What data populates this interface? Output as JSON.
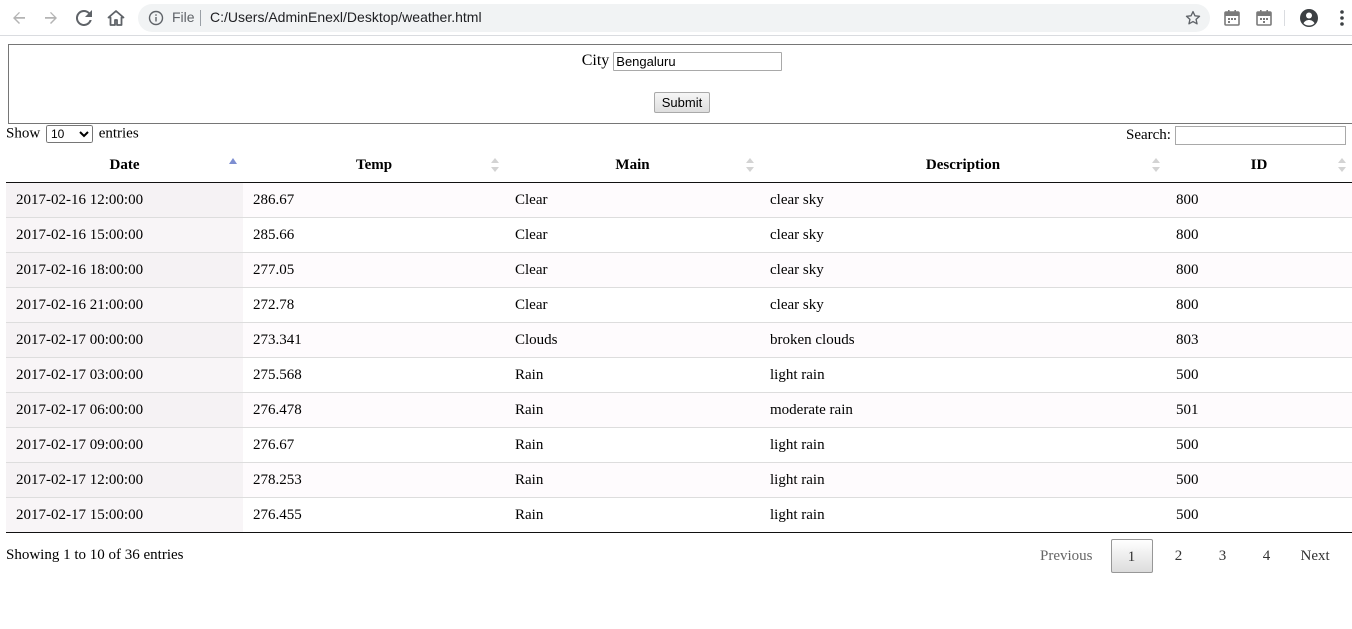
{
  "browser": {
    "file_label": "File",
    "url": "C:/Users/AdminEnexl/Desktop/weather.html",
    "icons": [
      "back-icon",
      "forward-icon",
      "reload-icon",
      "home-icon",
      "info-icon",
      "star-icon",
      "calendar-icon",
      "calendar-icon",
      "account-icon",
      "more-icon"
    ]
  },
  "form": {
    "city_label": "City",
    "city_value": "Bengaluru",
    "submit_label": "Submit"
  },
  "table_controls": {
    "show_label": "Show",
    "entries_label": "entries",
    "page_length": "10",
    "search_label": "Search:"
  },
  "table": {
    "columns": [
      "Date",
      "Temp",
      "Main",
      "Description",
      "ID"
    ],
    "sorted_column": "Date",
    "rows": [
      [
        "2017-02-16 12:00:00",
        "286.67",
        "Clear",
        "clear sky",
        "800"
      ],
      [
        "2017-02-16 15:00:00",
        "285.66",
        "Clear",
        "clear sky",
        "800"
      ],
      [
        "2017-02-16 18:00:00",
        "277.05",
        "Clear",
        "clear sky",
        "800"
      ],
      [
        "2017-02-16 21:00:00",
        "272.78",
        "Clear",
        "clear sky",
        "800"
      ],
      [
        "2017-02-17 00:00:00",
        "273.341",
        "Clouds",
        "broken clouds",
        "803"
      ],
      [
        "2017-02-17 03:00:00",
        "275.568",
        "Rain",
        "light rain",
        "500"
      ],
      [
        "2017-02-17 06:00:00",
        "276.478",
        "Rain",
        "moderate rain",
        "501"
      ],
      [
        "2017-02-17 09:00:00",
        "276.67",
        "Rain",
        "light rain",
        "500"
      ],
      [
        "2017-02-17 12:00:00",
        "278.253",
        "Rain",
        "light rain",
        "500"
      ],
      [
        "2017-02-17 15:00:00",
        "276.455",
        "Rain",
        "light rain",
        "500"
      ]
    ]
  },
  "footer": {
    "info": "Showing 1 to 10 of 36 entries",
    "previous": "Previous",
    "pages": [
      "1",
      "2",
      "3",
      "4"
    ],
    "current_page": "1",
    "next": "Next"
  },
  "colors": {
    "sort_active": "#7d8ed1",
    "sort_inactive": "#d3d3d3"
  }
}
